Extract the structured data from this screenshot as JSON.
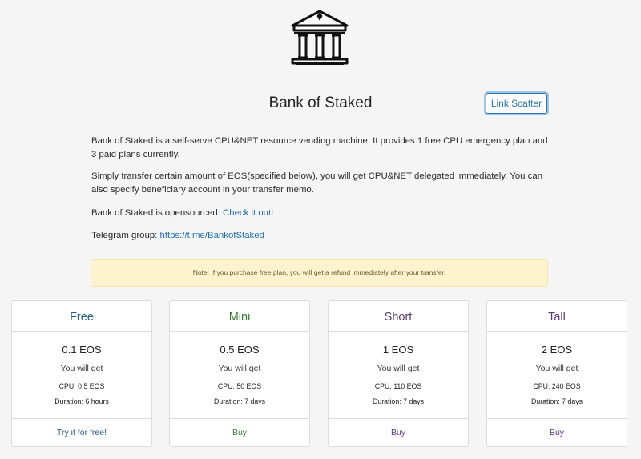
{
  "header": {
    "title": "Bank of Staked",
    "link_scatter_label": "Link Scatter"
  },
  "description": {
    "para1": "Bank of Staked is a self-serve CPU&NET resource vending machine. It provides 1 free CPU emergency plan and 3 paid plans currently.",
    "para2": "Simply transfer certain amount of EOS(specified below), you will get CPU&NET delegated immediately. You can also specify beneficiary account in your transfer memo.",
    "opensource_prefix": "Bank of Staked is opensourced: ",
    "opensource_link": "Check it out!",
    "telegram_prefix": "Telegram group: ",
    "telegram_link": "https://t.me/BankofStaked"
  },
  "note": "Note: If you purchase free plan, you will get a refund immediately after your transfer.",
  "plans": [
    {
      "name": "Free",
      "price": "0.1 EOS",
      "get": "You will get",
      "cpu": "CPU: 0.5 EOS",
      "duration": "Duration: 6 hours",
      "action": "Try it for free!",
      "color": "#2a5d8f",
      "action_color": "#2a5d8f"
    },
    {
      "name": "Mini",
      "price": "0.5 EOS",
      "get": "You will get",
      "cpu": "CPU: 50 EOS",
      "duration": "Duration: 7 days",
      "action": "Buy",
      "color": "#3b7d3b",
      "action_color": "#3b7d3b"
    },
    {
      "name": "Short",
      "price": "1 EOS",
      "get": "You will get",
      "cpu": "CPU: 110 EOS",
      "duration": "Duration: 7 days",
      "action": "Buy",
      "color": "#5a3d7a",
      "action_color": "#5a3d7a"
    },
    {
      "name": "Tall",
      "price": "2 EOS",
      "get": "You will get",
      "cpu": "CPU: 240 EOS",
      "duration": "Duration: 7 days",
      "action": "Buy",
      "color": "#5a3d7a",
      "action_color": "#5a3d7a"
    }
  ],
  "icons": {
    "logo": "bank-building-icon"
  }
}
